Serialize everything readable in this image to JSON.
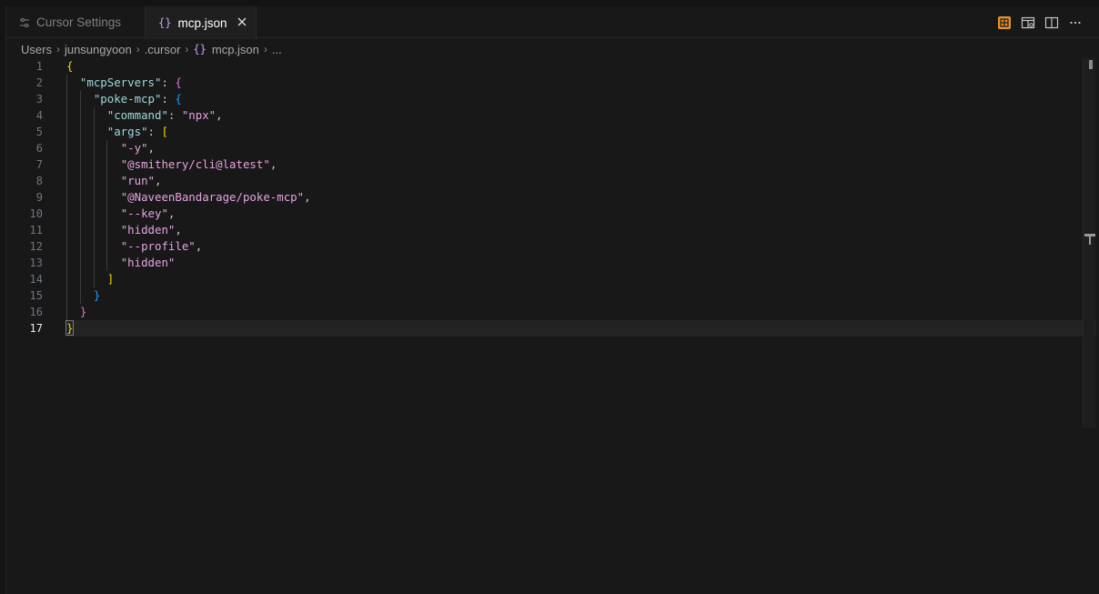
{
  "tabs": [
    {
      "label": "Cursor Settings",
      "icon": "settings-sliders-icon",
      "active": false
    },
    {
      "label": "mcp.json",
      "icon": "json-braces-icon",
      "active": true,
      "close": "×"
    }
  ],
  "breadcrumb": {
    "items": [
      "Users",
      "junsungyoon",
      ".cursor",
      "mcp.json",
      "..."
    ],
    "json_icon": "{}"
  },
  "editor": {
    "current_line": 17,
    "line_numbers": [
      "1",
      "2",
      "3",
      "4",
      "5",
      "6",
      "7",
      "8",
      "9",
      "10",
      "11",
      "12",
      "13",
      "14",
      "15",
      "16",
      "17"
    ],
    "code": {
      "l1_open": "{",
      "l2_key": "\"mcpServers\"",
      "l2_colon": ": ",
      "l2_open": "{",
      "l3_key": "\"poke-mcp\"",
      "l3_colon": ": ",
      "l3_open": "{",
      "l4_key": "\"command\"",
      "l4_colon": ": ",
      "l4_val": "\"npx\"",
      "l4_comma": ",",
      "l5_key": "\"args\"",
      "l5_colon": ": ",
      "l5_open": "[",
      "args": [
        {
          "value": "\"-y\"",
          "comma": ","
        },
        {
          "value": "\"@smithery/cli@latest\"",
          "comma": ","
        },
        {
          "value": "\"run\"",
          "comma": ","
        },
        {
          "value": "\"@NaveenBandarage/poke-mcp\"",
          "comma": ","
        },
        {
          "value": "\"--key\"",
          "comma": ","
        },
        {
          "value": "\"hidden\"",
          "comma": ","
        },
        {
          "value": "\"--profile\"",
          "comma": ","
        },
        {
          "value": "\"hidden\"",
          "comma": ""
        }
      ],
      "l14_close": "]",
      "l15_close": "}",
      "l16_close": "}",
      "l17_close": "}"
    }
  },
  "colors": {
    "key": "#9ed8e0",
    "string": "#e7a3e0",
    "bracket_level1": "#f1d700",
    "bracket_level2": "#da70d6",
    "bracket_level3": "#179fff",
    "background": "#181818"
  },
  "actions": [
    "table-preview-icon",
    "open-preview-icon",
    "split-editor-icon",
    "more-actions-icon"
  ]
}
